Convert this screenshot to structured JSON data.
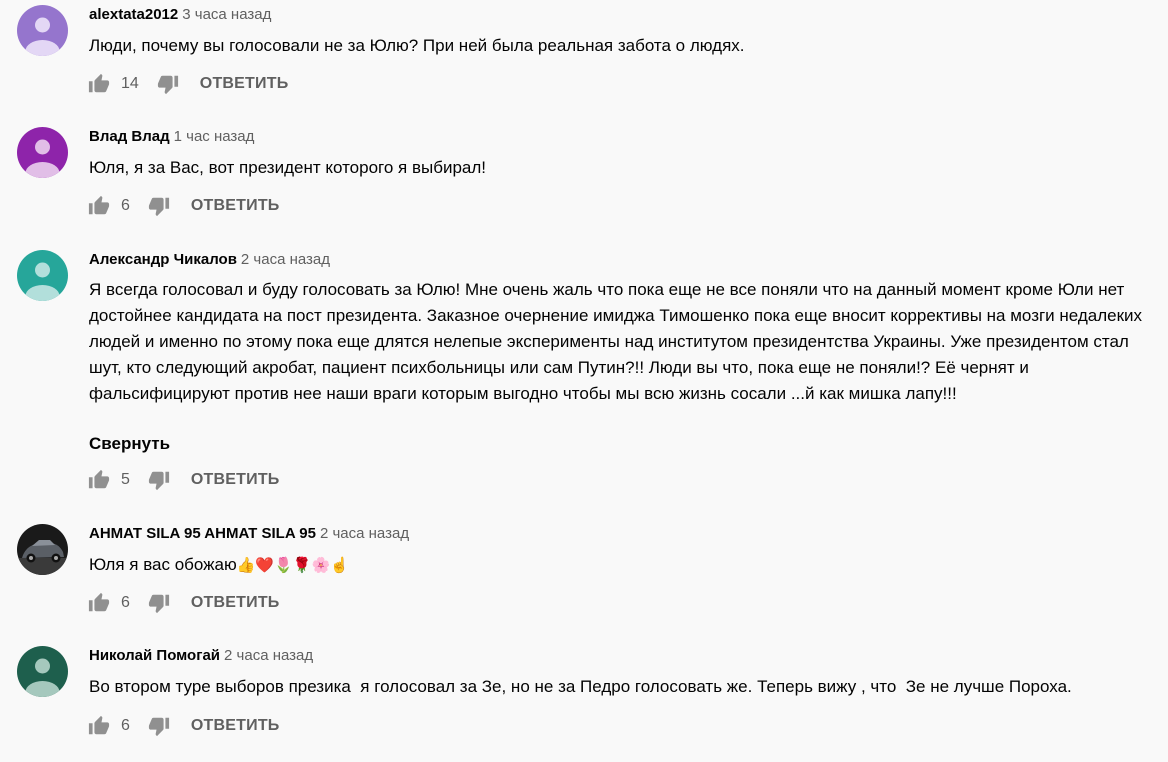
{
  "comments": [
    {
      "author": "alextata2012",
      "time": "3 часа назад",
      "text": "Люди, почему вы голосовали не за Юлю? При ней была реальная забота о людях.",
      "likes": "14",
      "reply_label": "ОТВЕТИТЬ",
      "avatar_color": "#9575cd"
    },
    {
      "author": "Влад Влад",
      "time": "1 час назад",
      "text": "Юля, я за Вас, вот президент которого я выбирал!",
      "likes": "6",
      "reply_label": "ОТВЕТИТЬ",
      "avatar_color": "#8e24aa"
    },
    {
      "author": "Александр Чикалов",
      "time": "2 часа назад",
      "text": "Я всегда голосовал и буду голосовать за Юлю! Мне очень жаль что пока еще не все поняли что на данный момент кроме Юли нет достойнее кандидата на пост президента. Заказное очернение имиджа Тимошенко пока еще вносит коррективы на мозги недалеких людей и именно по этому пока еще длятся нелепые эксперименты над институтом президентства Украины. Уже президентом стал шут, кто следующий акробат, пациент психбольницы или сам Путин?!! Люди вы что, пока еще не поняли!? Её чернят и фальсифицируют против нее наши враги которым выгодно чтобы мы всю жизнь сосали ...й как мишка лапу!!!",
      "collapse_label": "Свернуть",
      "likes": "5",
      "reply_label": "ОТВЕТИТЬ",
      "avatar_color": "#26a69a"
    },
    {
      "author": "AHMAT SILA 95 AHMAT SILA 95",
      "time": "2 часа назад",
      "text": "Юля я вас обожаю",
      "emojis": "👍❤️🌷🌹🌸☝️",
      "likes": "6",
      "reply_label": "ОТВЕТИТЬ",
      "avatar_image": "car-photo"
    },
    {
      "author": "Николай Помогай",
      "time": "2 часа назад",
      "text": "Во втором туре выборов презика  я голосовал за Зе, но не за Педро голосовать же. Теперь вижу , что  Зе не лучше Пороха.",
      "likes": "6",
      "reply_label": "ОТВЕТИТЬ",
      "avatar_color": "#1e5f4d"
    }
  ],
  "icons": {
    "like": "thumbs-up-icon",
    "dislike": "thumbs-down-icon"
  },
  "colors": {
    "secondary_text": "#606060",
    "background": "#f9f9f9"
  }
}
